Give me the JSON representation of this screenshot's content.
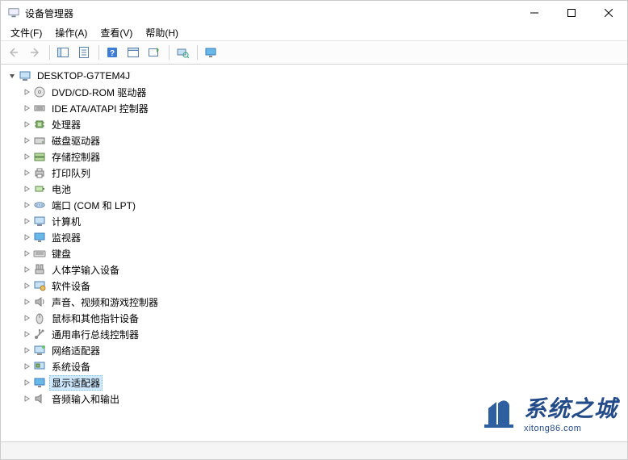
{
  "window": {
    "title": "设备管理器"
  },
  "menu": {
    "file": "文件(F)",
    "action": "操作(A)",
    "view": "查看(V)",
    "help": "帮助(H)"
  },
  "tree": {
    "root": {
      "label": "DESKTOP-G7TEM4J",
      "icon": "computer",
      "expanded": true,
      "children": [
        {
          "icon": "disc",
          "label": "DVD/CD-ROM 驱动器"
        },
        {
          "icon": "ide",
          "label": "IDE ATA/ATAPI 控制器"
        },
        {
          "icon": "cpu",
          "label": "处理器"
        },
        {
          "icon": "disk",
          "label": "磁盘驱动器"
        },
        {
          "icon": "storage",
          "label": "存储控制器"
        },
        {
          "icon": "printer",
          "label": "打印队列"
        },
        {
          "icon": "battery",
          "label": "电池"
        },
        {
          "icon": "port",
          "label": "端口 (COM 和 LPT)"
        },
        {
          "icon": "computer",
          "label": "计算机"
        },
        {
          "icon": "monitor",
          "label": "监视器"
        },
        {
          "icon": "keyboard",
          "label": "键盘"
        },
        {
          "icon": "hid",
          "label": "人体学输入设备"
        },
        {
          "icon": "software",
          "label": "软件设备"
        },
        {
          "icon": "sound",
          "label": "声音、视频和游戏控制器"
        },
        {
          "icon": "mouse",
          "label": "鼠标和其他指针设备"
        },
        {
          "icon": "usb",
          "label": "通用串行总线控制器"
        },
        {
          "icon": "network",
          "label": "网络适配器"
        },
        {
          "icon": "system",
          "label": "系统设备"
        },
        {
          "icon": "display",
          "label": "显示适配器",
          "selected": true
        },
        {
          "icon": "audio",
          "label": "音频输入和输出"
        }
      ]
    }
  },
  "watermark": {
    "main": "系统之城",
    "sub": "xitong86.com"
  }
}
